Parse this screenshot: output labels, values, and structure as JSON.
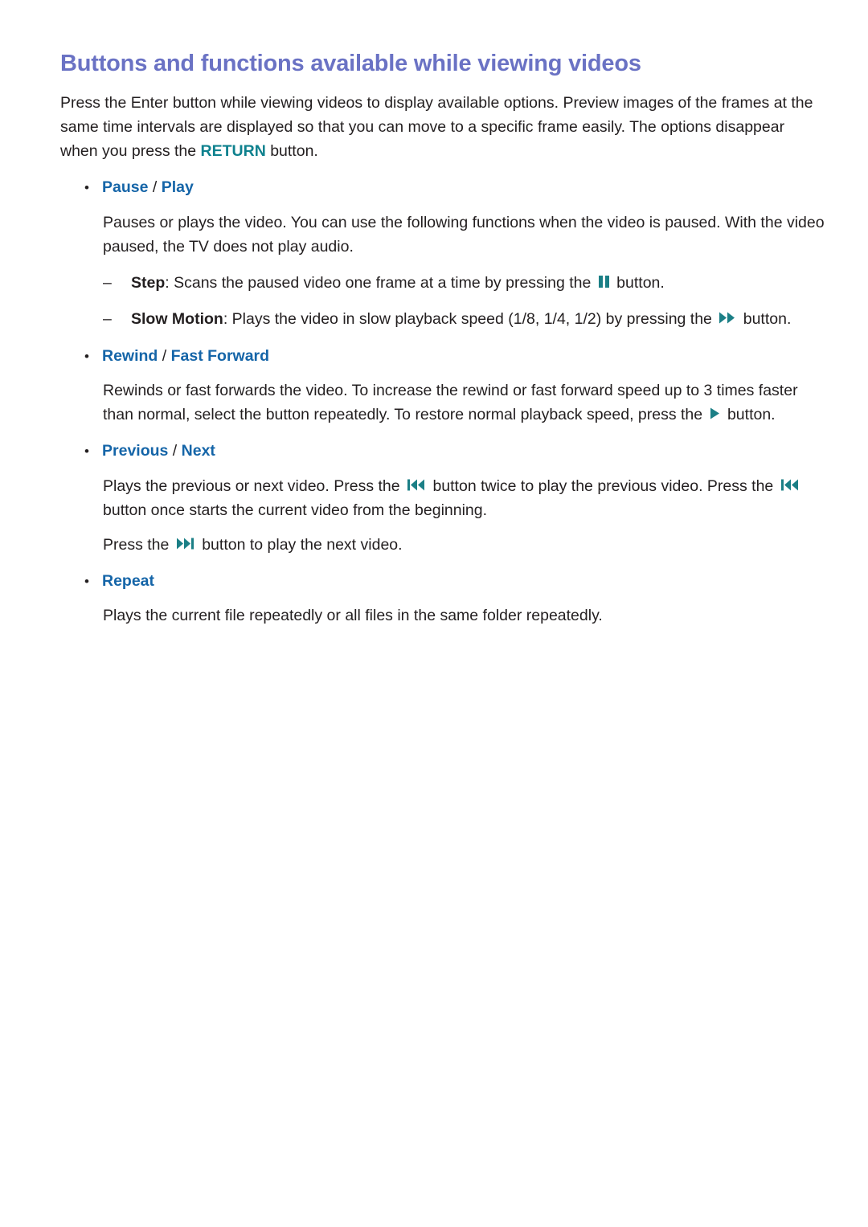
{
  "document": {
    "title": "Buttons and functions available while viewing videos",
    "intro_before_return": "Press the Enter button while viewing videos to display available options. Preview images of the frames at the same time intervals are displayed so that you can move to a specific frame easily. The options disappear when you press the ",
    "intro_keyword": "RETURN",
    "intro_after_return": " button."
  },
  "colors": {
    "title": "#6a72c4",
    "heading_blue": "#1565a8",
    "keyword_teal": "#0e818e",
    "icon_teal": "#1b7f86",
    "body_text": "#231f20",
    "background": "#ffffff"
  },
  "sections": [
    {
      "label_primary": "Pause",
      "separator": "/",
      "label_secondary": "Play",
      "paragraph": "Pauses or plays the video. You can use the following functions when the video is paused. With the video paused, the TV does not play audio.",
      "subitems": [
        {
          "dash": "–",
          "term": "Step",
          "colon": ":",
          "text_before_icon": " Scans the paused video one frame at a time by pressing the ",
          "icon": "pause-icon",
          "text_after_icon": " button."
        },
        {
          "dash": "–",
          "term": "Slow Motion",
          "colon": ":",
          "text_before_icon": " Plays the video in slow playback speed (1/8, 1/4, 1/2) by pressing the ",
          "icon": "fast-forward-icon",
          "text_after_icon": " button."
        }
      ]
    },
    {
      "label_primary": "Rewind",
      "separator": "/",
      "label_secondary": "Fast Forward",
      "paragraph_before_icon": "Rewinds or fast forwards the video. To increase the rewind or fast forward speed up to 3 times faster than normal, select the button repeatedly. To restore normal playback speed, press the ",
      "icon": "play-icon",
      "paragraph_after_icon": " button."
    },
    {
      "label_primary": "Previous",
      "separator": "/",
      "label_secondary": "Next",
      "paragraph_part1": "Plays the previous or next video. Press the ",
      "icon1": "previous-icon",
      "paragraph_part2": " button twice to play the previous video. Press the ",
      "icon2": "previous-icon",
      "paragraph_part3": " button once starts the current video from the beginning.",
      "paragraph2_part1": "Press the ",
      "icon3": "next-icon",
      "paragraph2_part2": " button to play the next video."
    },
    {
      "label_primary": "Repeat",
      "paragraph": "Plays the current file repeatedly or all files in the same folder repeatedly."
    }
  ],
  "bullet_marker": "•"
}
